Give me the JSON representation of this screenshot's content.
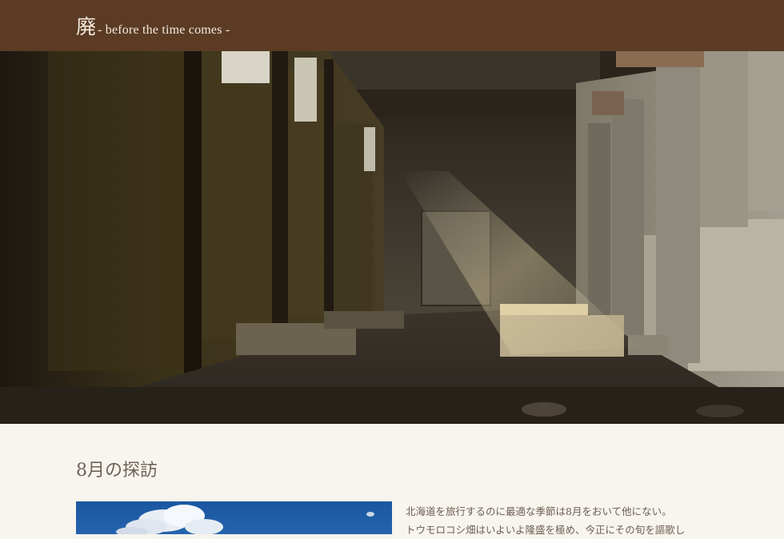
{
  "header": {
    "title_kanji": "廃",
    "tagline": "- before the time comes -"
  },
  "hero": {
    "image": "abandoned-factory-interior"
  },
  "section": {
    "heading": "8月の探訪",
    "photo": "blue-sky-with-clouds",
    "paragraphs": [
      "北海道を旅行するのに最適な季節は8月をおいて他にない。",
      "トウモロコシ畑はいよいよ隆盛を極め、今正にその旬を謳歌し"
    ]
  },
  "colors": {
    "header_bg": "#5b3b24",
    "page_bg": "#f8f4ee",
    "heading_text": "#6e6258"
  }
}
